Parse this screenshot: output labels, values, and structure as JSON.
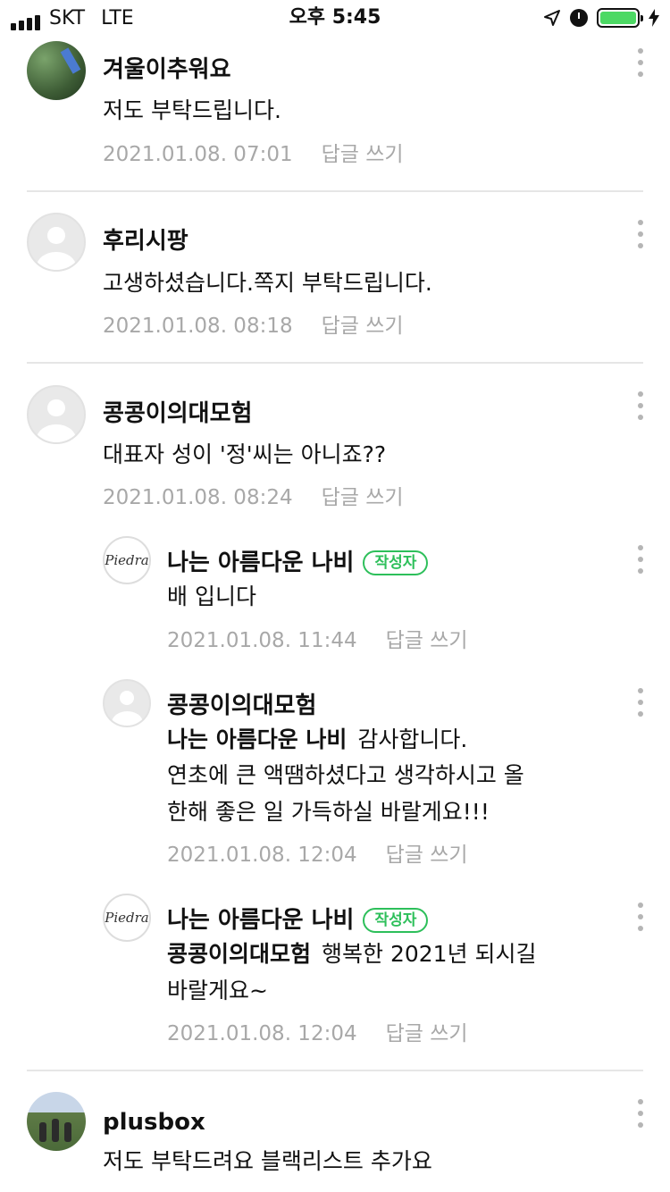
{
  "status_bar": {
    "carrier": "SKT",
    "network": "LTE",
    "time": "오후 5:45",
    "battery_color": "#4cd964"
  },
  "reply_label": "답글 쓰기",
  "author_badge": "작성자",
  "comments": [
    {
      "author": "겨울이추워요",
      "text": "저도 부탁드립니다.",
      "date": "2021.01.08. 07:01"
    },
    {
      "author": "후리시팡",
      "text": "고생하셨습니다.쪽지 부탁드립니다.",
      "date": "2021.01.08. 08:18"
    },
    {
      "author": "콩콩이의대모험",
      "text": "대표자 성이 '정'씨는 아니죠??",
      "date": "2021.01.08. 08:24"
    },
    {
      "author": "나는 아름다운 나비",
      "text": "배 입니다",
      "date": "2021.01.08. 11:44"
    },
    {
      "author": "콩콩이의대모험",
      "mention": "나는 아름다운 나비",
      "text_line1": "감사합니다.",
      "text_line2": "연초에 큰 액땜하셨다고 생각하시고 올",
      "text_line3": "한해 좋은 일 가득하실 바랄게요!!!",
      "date": "2021.01.08. 12:04"
    },
    {
      "author": "나는 아름다운 나비",
      "mention": "콩콩이의대모험",
      "text_line1": "행복한 2021년 되시길",
      "text_line2": "바랄게요~",
      "date": "2021.01.08. 12:04"
    },
    {
      "author": "plusbox",
      "text": "저도 부탁드려요 블랙리스트 추가요"
    }
  ],
  "logo_text": "Piedra",
  "icons": {
    "more": "more-vertical-icon",
    "location": "location-arrow-icon",
    "alarm": "alarm-icon",
    "charging": "charging-bolt-icon"
  }
}
